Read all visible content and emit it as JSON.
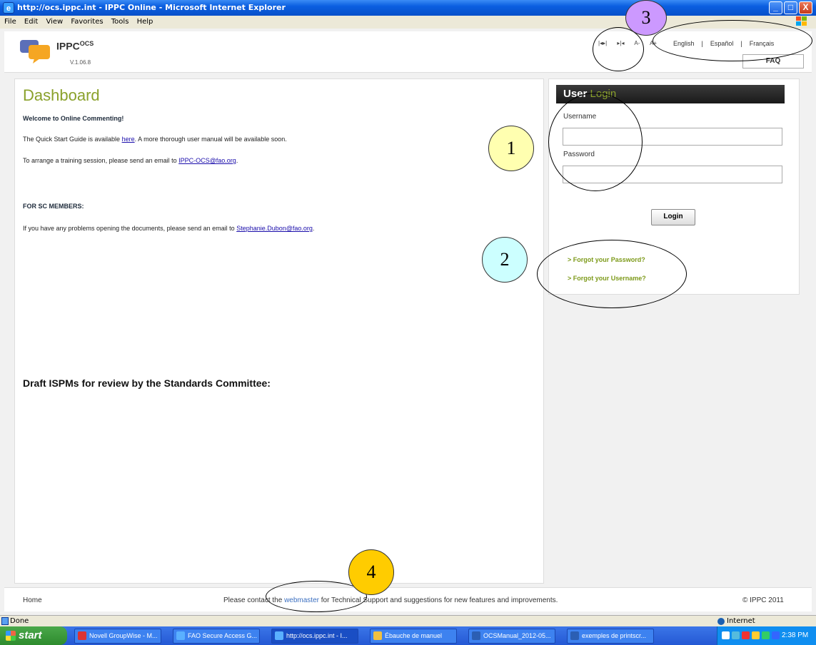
{
  "window": {
    "title": "http://ocs.ippc.int - IPPC Online - Microsoft Internet Explorer",
    "minimize": "_",
    "maximize": "□",
    "close": "X"
  },
  "menu": [
    "File",
    "Edit",
    "View",
    "Favorites",
    "Tools",
    "Help"
  ],
  "header": {
    "logo_name": "IPPC",
    "logo_sup": "OCS",
    "version": "V.1.06.8",
    "toolbar_icons": [
      "|◂▸|",
      "▸|◂",
      "A-",
      "A+"
    ],
    "languages": [
      "English",
      "Español",
      "Français"
    ],
    "lang_sep": "|",
    "faq": "FAQ"
  },
  "dashboard": {
    "title": "Dashboard",
    "welcome": "Welcome to Online Commenting!",
    "quickstart_pre": "The Quick Start Guide is available ",
    "quickstart_link": "here",
    "quickstart_post": ". A more thorough user manual will be available soon.",
    "training_pre": "To arrange a training session, please send an email to ",
    "training_link": "IPPC-OCS@fao.org",
    "training_post": ".",
    "sc_heading": "FOR SC MEMBERS:",
    "sc_pre": "If you have any problems opening the documents, please send an email to ",
    "sc_link": "Stephanie.Dubon@fao.org",
    "sc_post": ".",
    "draft_title": "Draft ISPMs for review by the Standards Committee:"
  },
  "login": {
    "title_a": "User ",
    "title_b": "Login",
    "username_label": "Username",
    "username_value": "",
    "password_label": "Password",
    "password_value": "",
    "button": "Login",
    "forgot_password": "> Forgot your Password?",
    "forgot_username": "> Forgot your Username?"
  },
  "footer": {
    "home": "Home",
    "contact_pre": "Please contact the ",
    "contact_link": "webmaster",
    "contact_post": " for Technical Support and suggestions for new features and improvements.",
    "copyright": "© IPPC 2011"
  },
  "statusbar": {
    "status": "Done",
    "zone": "Internet"
  },
  "taskbar": {
    "start": "start",
    "tasks": [
      "Novell GroupWise - M...",
      "FAO Secure Access G...",
      "http://ocs.ippc.int - I...",
      "Ébauche de manuel",
      "OCSManual_2012-05...",
      "exemples de printscr..."
    ],
    "clock": "2:38 PM"
  },
  "annotations": [
    "1",
    "2",
    "3",
    "4"
  ],
  "colors": {
    "accent_green": "#8aa12b",
    "annotation_1": "#ffffb0",
    "annotation_2": "#ccffff",
    "annotation_3": "#cc99ff",
    "annotation_4": "#ffcc00"
  }
}
